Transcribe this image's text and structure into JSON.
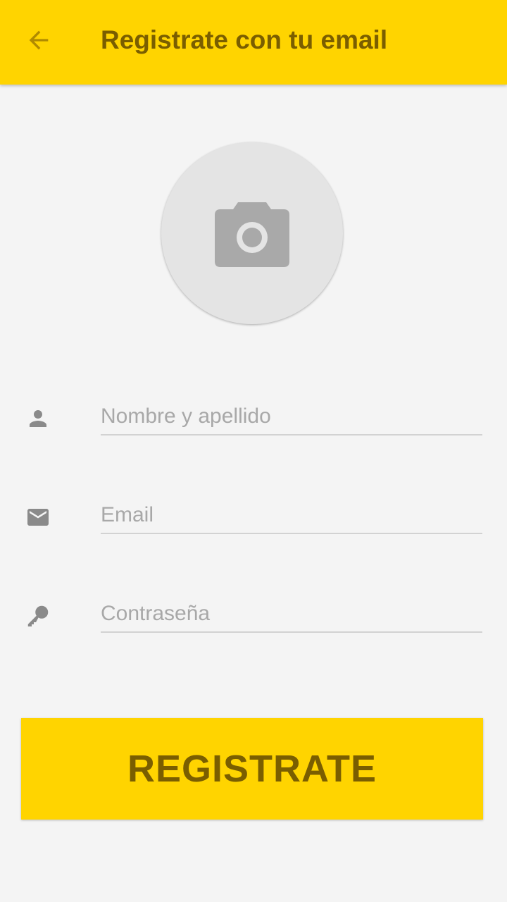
{
  "appbar": {
    "title": "Registrate con tu email",
    "back_icon": "arrow-back-icon",
    "color": "#ffd400",
    "text_color": "#7a5e00"
  },
  "avatar": {
    "icon": "camera-icon"
  },
  "form": {
    "name": {
      "placeholder": "Nombre y apellido",
      "value": "",
      "icon": "person-icon"
    },
    "email": {
      "placeholder": "Email",
      "value": "",
      "icon": "mail-icon"
    },
    "password": {
      "placeholder": "Contraseña",
      "value": "",
      "icon": "key-icon"
    }
  },
  "register_button": {
    "label": "REGISTRATE"
  }
}
